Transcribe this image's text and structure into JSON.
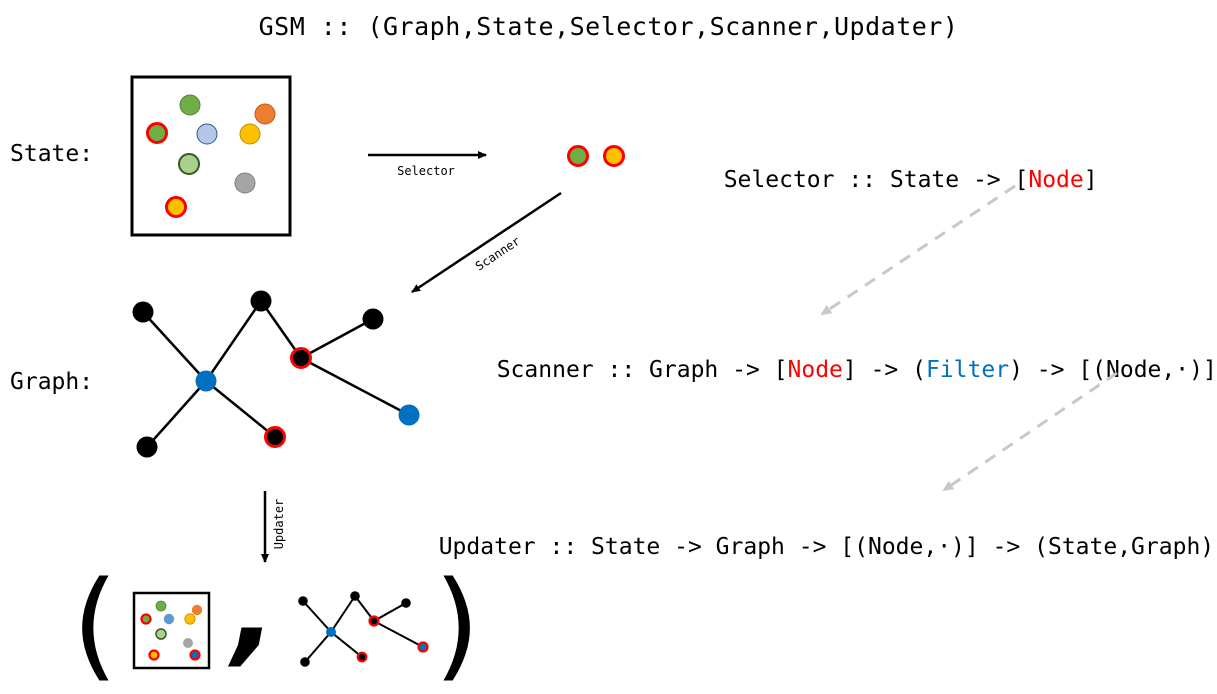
{
  "title": "GSM :: (Graph,State,Selector,Scanner,Updater)",
  "labels": {
    "state": "State:",
    "graph": "Graph:"
  },
  "arrows": {
    "selector": "Selector",
    "scanner": "Scanner",
    "updater": "Updater"
  },
  "signatures": {
    "selector": {
      "parts": [
        {
          "text": "Selector :: State -> [",
          "color": "default"
        },
        {
          "text": "Node",
          "color": "red"
        },
        {
          "text": "]",
          "color": "default"
        }
      ]
    },
    "scanner": {
      "parts": [
        {
          "text": "Scanner :: Graph -> [",
          "color": "default"
        },
        {
          "text": "Node",
          "color": "red"
        },
        {
          "text": "] -> (",
          "color": "default"
        },
        {
          "text": "Filter",
          "color": "blue"
        },
        {
          "text": ") -> [(Node,·)]",
          "color": "default"
        }
      ]
    },
    "updater": {
      "parts": [
        {
          "text": "Updater :: State -> Graph -> [(Node,·)] -> (State,Graph)",
          "color": "default"
        }
      ]
    }
  },
  "result_tuple": {
    "open": "(",
    "separator": ",",
    "close": ")"
  },
  "colors": {
    "highlight_red": "#ff0000",
    "filter_blue": "#0070c0",
    "green": "#70ad47",
    "light_green": "#a9d18e",
    "light_blue": "#b4c7e7",
    "orange": "#ed7d31",
    "gold": "#ffc000",
    "gray": "#a5a5a5",
    "dashed_arrow": "#c8c8c8"
  },
  "state_nodes": [
    {
      "id": "n-green-top",
      "fill": "green",
      "selected": false
    },
    {
      "id": "n-orange",
      "fill": "orange",
      "selected": false
    },
    {
      "id": "n-green-selected",
      "fill": "green",
      "selected": true
    },
    {
      "id": "n-lightblue",
      "fill": "light_blue",
      "selected": false
    },
    {
      "id": "n-gold",
      "fill": "gold",
      "selected": false
    },
    {
      "id": "n-lightgreen",
      "fill": "light_green",
      "selected": false
    },
    {
      "id": "n-gray",
      "fill": "gray",
      "selected": false
    },
    {
      "id": "n-gold-selected",
      "fill": "gold",
      "selected": true
    }
  ],
  "selected_nodes": [
    {
      "fill": "green"
    },
    {
      "fill": "gold"
    }
  ]
}
